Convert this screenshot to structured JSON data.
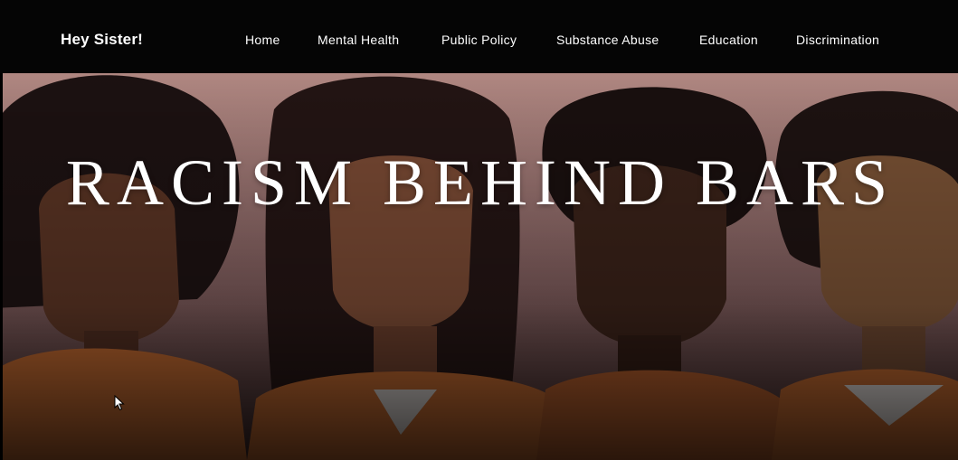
{
  "brand": {
    "name": "Hey Sister!"
  },
  "nav": {
    "items": [
      {
        "label": "Home"
      },
      {
        "label": "Mental Health"
      },
      {
        "label": "Public Policy"
      },
      {
        "label": "Substance Abuse"
      },
      {
        "label": "Education"
      },
      {
        "label": "Discrimination"
      }
    ]
  },
  "hero": {
    "title": "RACISM BEHIND BARS",
    "image_subject": "illustration of four Black women in orange prison uniforms"
  },
  "colors": {
    "navbar_bg": "#050505",
    "hero_bg_top": "#b98e88",
    "uniform_orange": "#b8642e",
    "text": "#ffffff"
  }
}
